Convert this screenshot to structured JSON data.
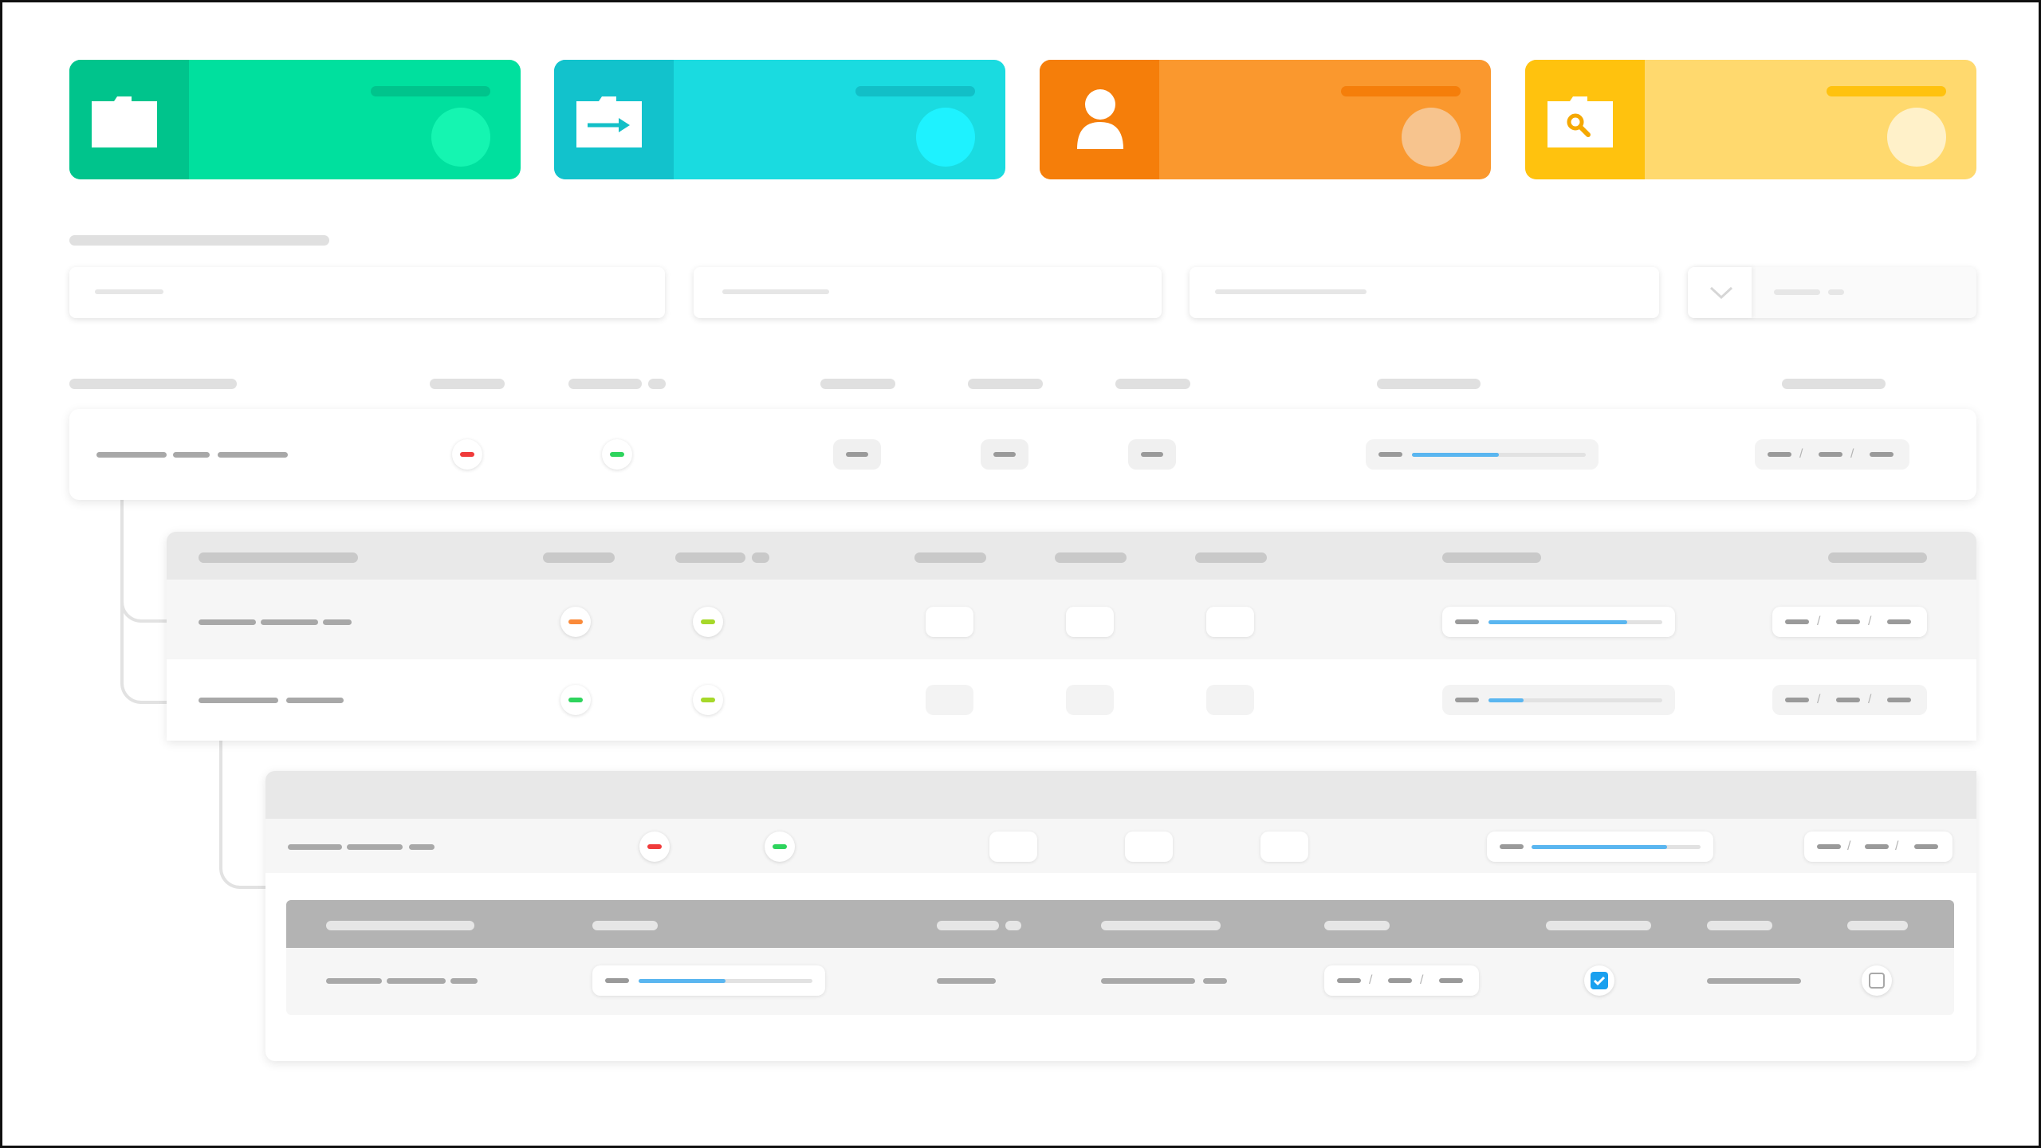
{
  "cards": [
    {
      "icon": "folder-icon",
      "accent": "#00c48c",
      "body": "#00e09e",
      "bar": "#00c48c",
      "circle": "#15f5b1"
    },
    {
      "icon": "folder-transfer-icon",
      "accent": "#12c2cc",
      "body": "#1adbe0",
      "bar": "#12bfc7",
      "circle": "#1ef2ff"
    },
    {
      "icon": "user-icon",
      "accent": "#f57e0a",
      "body": "#fa982e",
      "bar": "#f57e0a",
      "circle": "#f7c48e"
    },
    {
      "icon": "folder-search-icon",
      "accent": "#ffc20e",
      "body": "#ffd96e",
      "bar": "#ffc20e",
      "circle": "#fff1c9"
    }
  ],
  "status_colors": {
    "red": "#f03b3b",
    "green": "#2ed45d",
    "orange": "#fa8a3a",
    "lime": "#a6d82a"
  },
  "progress_color": "#5ab6f0",
  "rows": {
    "level0": {
      "status1": "red",
      "status2": "green",
      "progress": 0.5
    },
    "level1": [
      {
        "status1": "orange",
        "status2": "lime",
        "progress": 0.8
      },
      {
        "status1": "green",
        "status2": "lime",
        "progress": 0.2
      }
    ],
    "level2": {
      "status1": "red",
      "status2": "green",
      "progress": 0.8
    },
    "level3": {
      "progress": 0.5,
      "checkbox1": true,
      "checkbox2": false
    }
  }
}
